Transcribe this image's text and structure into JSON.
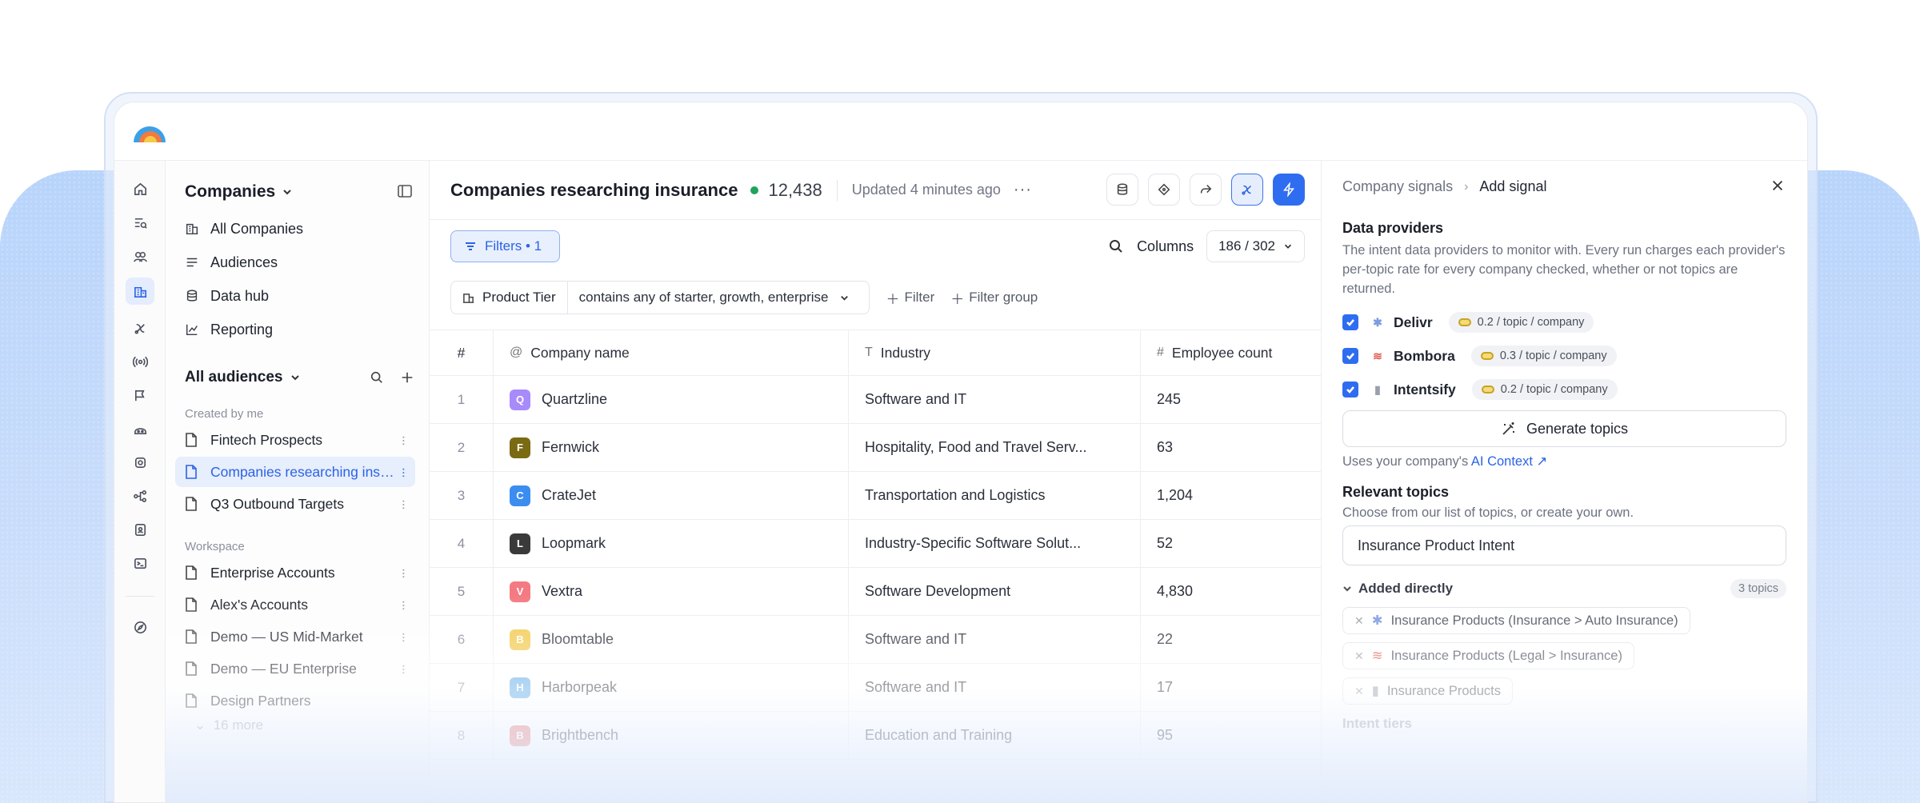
{
  "colors": {
    "accent": "#2f6df0",
    "status_live": "#22a35a"
  },
  "sidebar": {
    "title": "Companies",
    "nav": [
      {
        "label": "All Companies",
        "icon": "building-icon"
      },
      {
        "label": "Audiences",
        "icon": "list-icon"
      },
      {
        "label": "Data hub",
        "icon": "database-icon"
      },
      {
        "label": "Reporting",
        "icon": "chart-icon"
      }
    ],
    "audiences_title": "All audiences",
    "created_label": "Created by me",
    "created": [
      {
        "label": "Fintech Prospects"
      },
      {
        "label": "Companies researching insurance",
        "active": true
      },
      {
        "label": "Q3 Outbound Targets"
      }
    ],
    "workspace_label": "Workspace",
    "workspace": [
      {
        "label": "Enterprise Accounts"
      },
      {
        "label": "Alex's Accounts"
      },
      {
        "label": "Demo — US Mid-Market"
      },
      {
        "label": "Demo — EU Enterprise"
      },
      {
        "label": "Design Partners"
      }
    ],
    "more_label": "16 more"
  },
  "main": {
    "title": "Companies researching insurance",
    "count": "12,438",
    "updated": "Updated 4 minutes ago",
    "filters_label": "Filters • 1",
    "columns_label": "Columns",
    "columns_count": "186 / 302",
    "filter": {
      "field": "Product Tier",
      "value": "contains any of starter, growth, enterprise"
    },
    "add_filter": "Filter",
    "add_filter_group": "Filter group",
    "columns": [
      {
        "label": "#",
        "icon": ""
      },
      {
        "label": "Company name",
        "icon": "@"
      },
      {
        "label": "Industry",
        "icon": "T"
      },
      {
        "label": "Employee count",
        "icon": "#"
      }
    ],
    "rows": [
      {
        "n": "1",
        "initial": "Q",
        "name": "Quartzline",
        "industry": "Software and IT",
        "employees": "245",
        "color": "#a78bfa"
      },
      {
        "n": "2",
        "initial": "F",
        "name": "Fernwick",
        "industry": "Hospitality, Food and Travel Serv...",
        "employees": "63",
        "color": "#7a6a12"
      },
      {
        "n": "3",
        "initial": "C",
        "name": "CrateJet",
        "industry": "Transportation and Logistics",
        "employees": "1,204",
        "color": "#3b8df0"
      },
      {
        "n": "4",
        "initial": "L",
        "name": "Loopmark",
        "industry": "Industry-Specific Software Solut...",
        "employees": "52",
        "color": "#3a3a3a"
      },
      {
        "n": "5",
        "initial": "V",
        "name": "Vextra",
        "industry": "Software Development",
        "employees": "4,830",
        "color": "#f47a82"
      },
      {
        "n": "6",
        "initial": "B",
        "name": "Bloomtable",
        "industry": "Software and IT",
        "employees": "22",
        "color": "#f2c94c"
      },
      {
        "n": "7",
        "initial": "H",
        "name": "Harborpeak",
        "industry": "Software and IT",
        "employees": "17",
        "color": "#5aa9e6"
      },
      {
        "n": "8",
        "initial": "B",
        "name": "Brightbench",
        "industry": "Education and Training",
        "employees": "95",
        "color": "#e57373"
      }
    ]
  },
  "panel": {
    "crumb_parent": "Company signals",
    "crumb_current": "Add signal",
    "providers_title": "Data providers",
    "providers_desc": "The intent data providers to monitor with. Every run charges each provider's per-topic rate for every company checked, whether or not topics are returned.",
    "providers": [
      {
        "name": "Delivr",
        "rate": "0.2 / topic / company",
        "icon": "asterisk-icon"
      },
      {
        "name": "Bombora",
        "rate": "0.3 / topic / company",
        "icon": "waves-icon"
      },
      {
        "name": "Intentsify",
        "rate": "0.2 / topic / company",
        "icon": "bars-icon"
      }
    ],
    "generate_label": "Generate topics",
    "context_prefix": "Uses your company's",
    "context_link": "AI Context ↗",
    "topics_title": "Relevant topics",
    "topics_desc": "Choose from our list of topics, or create your own.",
    "topic_input_value": "Insurance Product Intent",
    "added_label": "Added directly",
    "added_count": "3 topics",
    "chips": [
      {
        "label": "Insurance Products (Insurance > Auto Insurance)",
        "icon": "asterisk-icon"
      },
      {
        "label": "Insurance Products (Legal > Insurance)",
        "icon": "waves-icon"
      },
      {
        "label": "Insurance Products",
        "icon": "bars-icon"
      }
    ],
    "intent_tiers_label": "Intent tiers"
  }
}
